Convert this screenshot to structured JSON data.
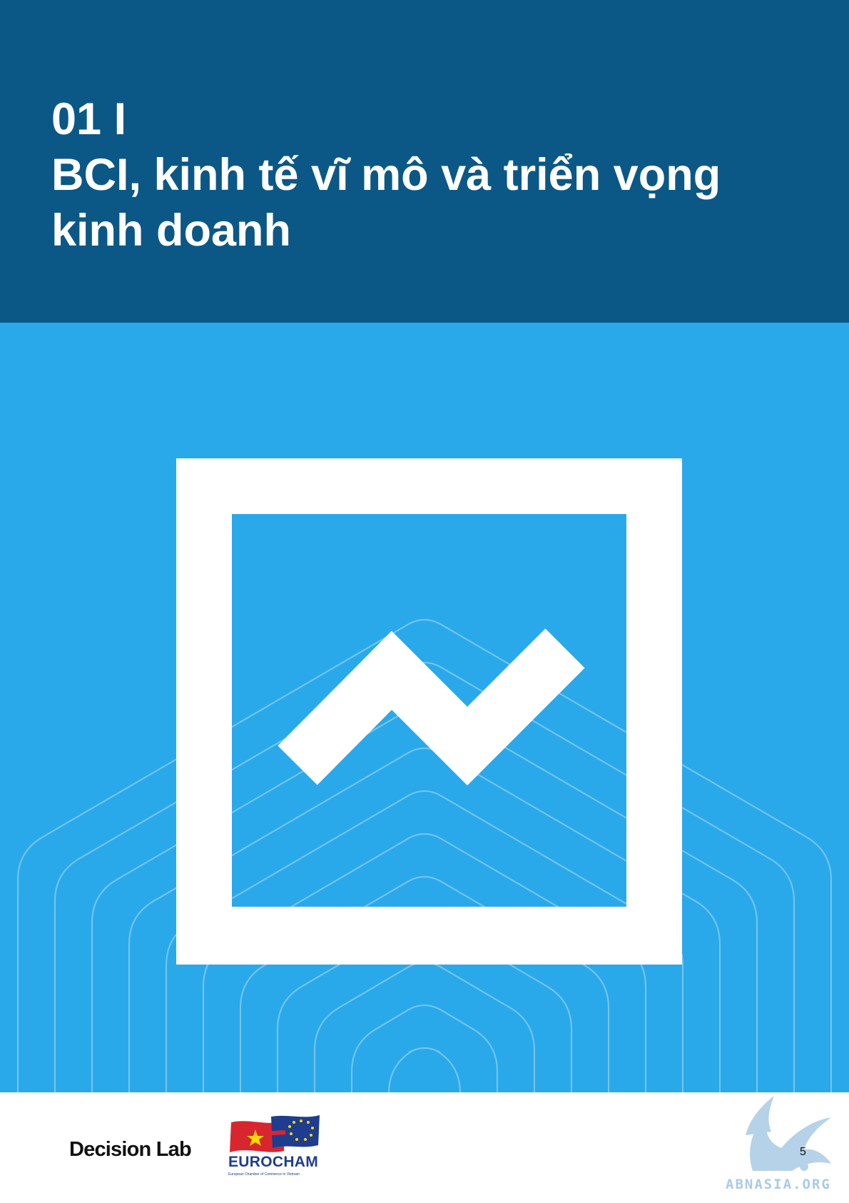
{
  "header": {
    "title_line1": "01 I",
    "title_line2": "BCI, kinh tế vĩ mô và triển vọng",
    "title_line3": "kinh doanh"
  },
  "hero": {
    "icon": "trend-chart-icon",
    "background_color": "#2aa9ea",
    "pattern": "concentric-outline-lines"
  },
  "footer": {
    "decision_lab": "Decision Lab",
    "eurocham": "EUROCHAM",
    "eurocham_tagline": "European Chamber of Commerce in Vietnam",
    "watermark": "ABNASIA.ORG",
    "page_number": "5"
  },
  "colors": {
    "header_band": "#0b5886",
    "hero_band": "#2aa9ea",
    "title_text": "#ffffff",
    "eurocham_blue": "#1e3d8f",
    "watermark": "#a9cbe6"
  }
}
